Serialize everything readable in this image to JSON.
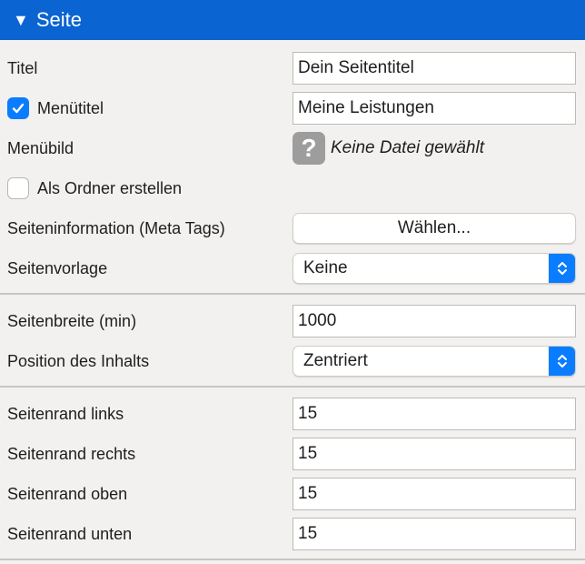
{
  "section": {
    "title": "Seite",
    "toggle_icon": "disclosure-triangle-down-icon"
  },
  "fields": {
    "titel": {
      "label": "Titel",
      "value": "Dein Seitentitel"
    },
    "menuetitel": {
      "label": "Menütitel",
      "checked": true,
      "value": "Meine Leistungen"
    },
    "menuebild": {
      "label": "Menübild",
      "status": "Keine Datei gewählt",
      "icon": "question-mark-icon"
    },
    "ordner": {
      "label": "Als Ordner erstellen",
      "checked": false
    },
    "seiteninformation": {
      "label": "Seiteninformation (Meta Tags)",
      "button": "Wählen..."
    },
    "seitenvorlage": {
      "label": "Seitenvorlage",
      "selected": "Keine"
    },
    "seitenbreite": {
      "label": "Seitenbreite (min)",
      "value": "1000"
    },
    "position": {
      "label": "Position des Inhalts",
      "selected": "Zentriert"
    },
    "rand_links": {
      "label": "Seitenrand links",
      "value": "15"
    },
    "rand_rechts": {
      "label": "Seitenrand rechts",
      "value": "15"
    },
    "rand_oben": {
      "label": "Seitenrand oben",
      "value": "15"
    },
    "rand_unten": {
      "label": "Seitenrand unten",
      "value": "15"
    }
  },
  "colors": {
    "header": "#0a64d2",
    "accent": "#0a7cff",
    "background": "#f3f1ef"
  }
}
